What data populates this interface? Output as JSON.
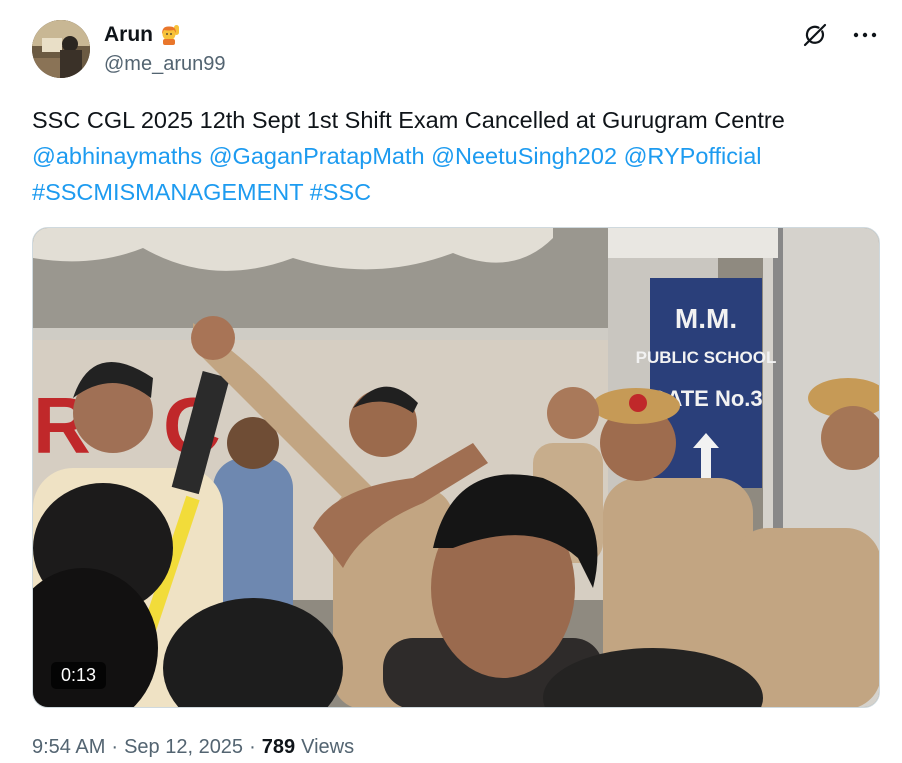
{
  "author": {
    "name": "Arun",
    "emoji": "🙋",
    "handle": "@me_arun99"
  },
  "actions": {
    "grok_icon": "grok-icon",
    "more_icon": "more-icon"
  },
  "tweet": {
    "text": "SSC CGL 2025 12th Sept 1st Shift Exam Cancelled at Gurugram Centre",
    "mentions": [
      "@abhinaymaths",
      "@GaganPratapMath",
      "@NeetuSingh202",
      "@RYPofficial"
    ],
    "hashtags": [
      "#SSCMISMANAGEMENT",
      "#SSC"
    ]
  },
  "media": {
    "duration": "0:13",
    "sign_line1": "M.M.",
    "sign_line2": "PUBLIC SCHOOL",
    "sign_line3": "GATE No.3"
  },
  "meta": {
    "time": "9:54 AM",
    "separator": "·",
    "date": "Sep 12, 2025",
    "views_count": "789",
    "views_label": "Views"
  },
  "colors": {
    "link": "#1d9bf0",
    "secondary": "#536471",
    "police_uniform": "#c2a582",
    "sign_blue": "#2a3f7a"
  }
}
